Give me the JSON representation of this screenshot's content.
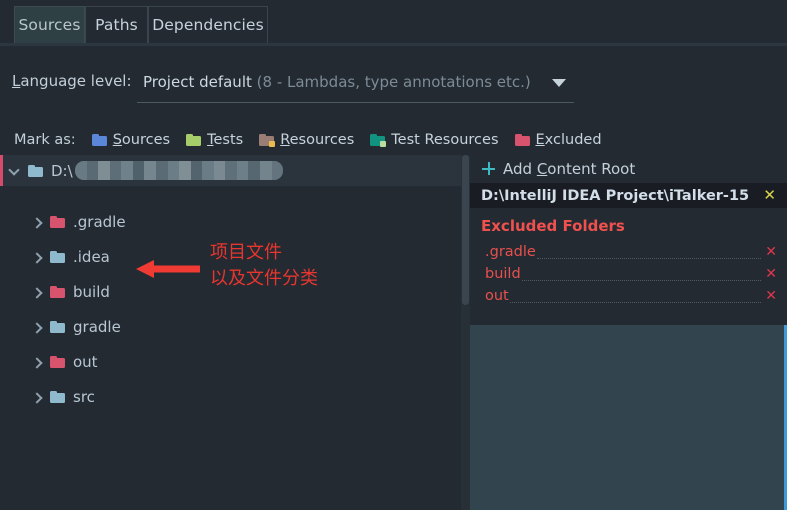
{
  "window": {
    "theme_bg": "#232a31",
    "accent_excluded": "#e8504e",
    "accent_add": "#3fb9c4"
  },
  "tabs": [
    {
      "label": "Sources",
      "active": true
    },
    {
      "label": "Paths",
      "active": false
    },
    {
      "label": "Dependencies",
      "active": false
    }
  ],
  "language_level": {
    "label": "Language level:",
    "mnemonic": "L",
    "value_primary": "Project default",
    "value_hint": "(8 - Lambdas, type annotations etc.)",
    "dropdown_icon": "chevron-down-icon"
  },
  "mark_as": {
    "label": "Mark as:",
    "options": [
      {
        "label": "Sources",
        "mnemonic": "S",
        "color": "#5b87d8",
        "badge": null,
        "icon": "folder-sources-icon"
      },
      {
        "label": "Tests",
        "mnemonic": "T",
        "color": "#a5cd6a",
        "badge": null,
        "icon": "folder-tests-icon"
      },
      {
        "label": "Resources",
        "mnemonic": "R",
        "color": "#9a7d74",
        "badge": "#e8bb4a",
        "icon": "folder-resources-icon"
      },
      {
        "label": "Test Resources",
        "mnemonic": "",
        "color": "#12937f",
        "badge": "#b9dca0",
        "icon": "folder-test-resources-icon"
      },
      {
        "label": "Excluded",
        "mnemonic": "E",
        "color": "#d8536e",
        "badge": null,
        "icon": "folder-excluded-icon"
      }
    ]
  },
  "tree": {
    "root": {
      "prefix": "D:\\",
      "redacted": true,
      "expanded": true,
      "selected": true,
      "folder_color": "#8fb9cd",
      "chevron": "chevron-down-icon"
    },
    "children": [
      {
        "label": ".gradle",
        "folder_color": "#d8536e",
        "chevron": "chevron-right-icon",
        "excluded": true
      },
      {
        "label": ".idea",
        "folder_color": "#8fb9cd",
        "chevron": "chevron-right-icon",
        "excluded": false
      },
      {
        "label": "build",
        "folder_color": "#d8536e",
        "chevron": "chevron-right-icon",
        "excluded": true
      },
      {
        "label": "gradle",
        "folder_color": "#8fb9cd",
        "chevron": "chevron-right-icon",
        "excluded": false
      },
      {
        "label": "out",
        "folder_color": "#d8536e",
        "chevron": "chevron-right-icon",
        "excluded": true
      },
      {
        "label": "src",
        "folder_color": "#8fb9cd",
        "chevron": "chevron-right-icon",
        "excluded": false
      }
    ]
  },
  "annotation": {
    "line1": "项目文件",
    "line2": "以及文件分类",
    "color": "#e8352f",
    "arrow": "left-arrow-annotation"
  },
  "right_panel": {
    "add_content_root": {
      "label_before": "Add ",
      "mnemonic": "C",
      "label_after": "ontent Root",
      "icon": "plus-icon"
    },
    "content_root": {
      "path": "D:\\IntelliJ IDEA Project\\iTalker-15",
      "remove_label": "✕",
      "remove_color": "#d9d34a"
    },
    "excluded_section": {
      "title": "Excluded Folders",
      "items": [
        {
          "name": ".gradle",
          "remove_label": "✕"
        },
        {
          "name": "build",
          "remove_label": "✕"
        },
        {
          "name": "out",
          "remove_label": "✕"
        }
      ]
    }
  }
}
